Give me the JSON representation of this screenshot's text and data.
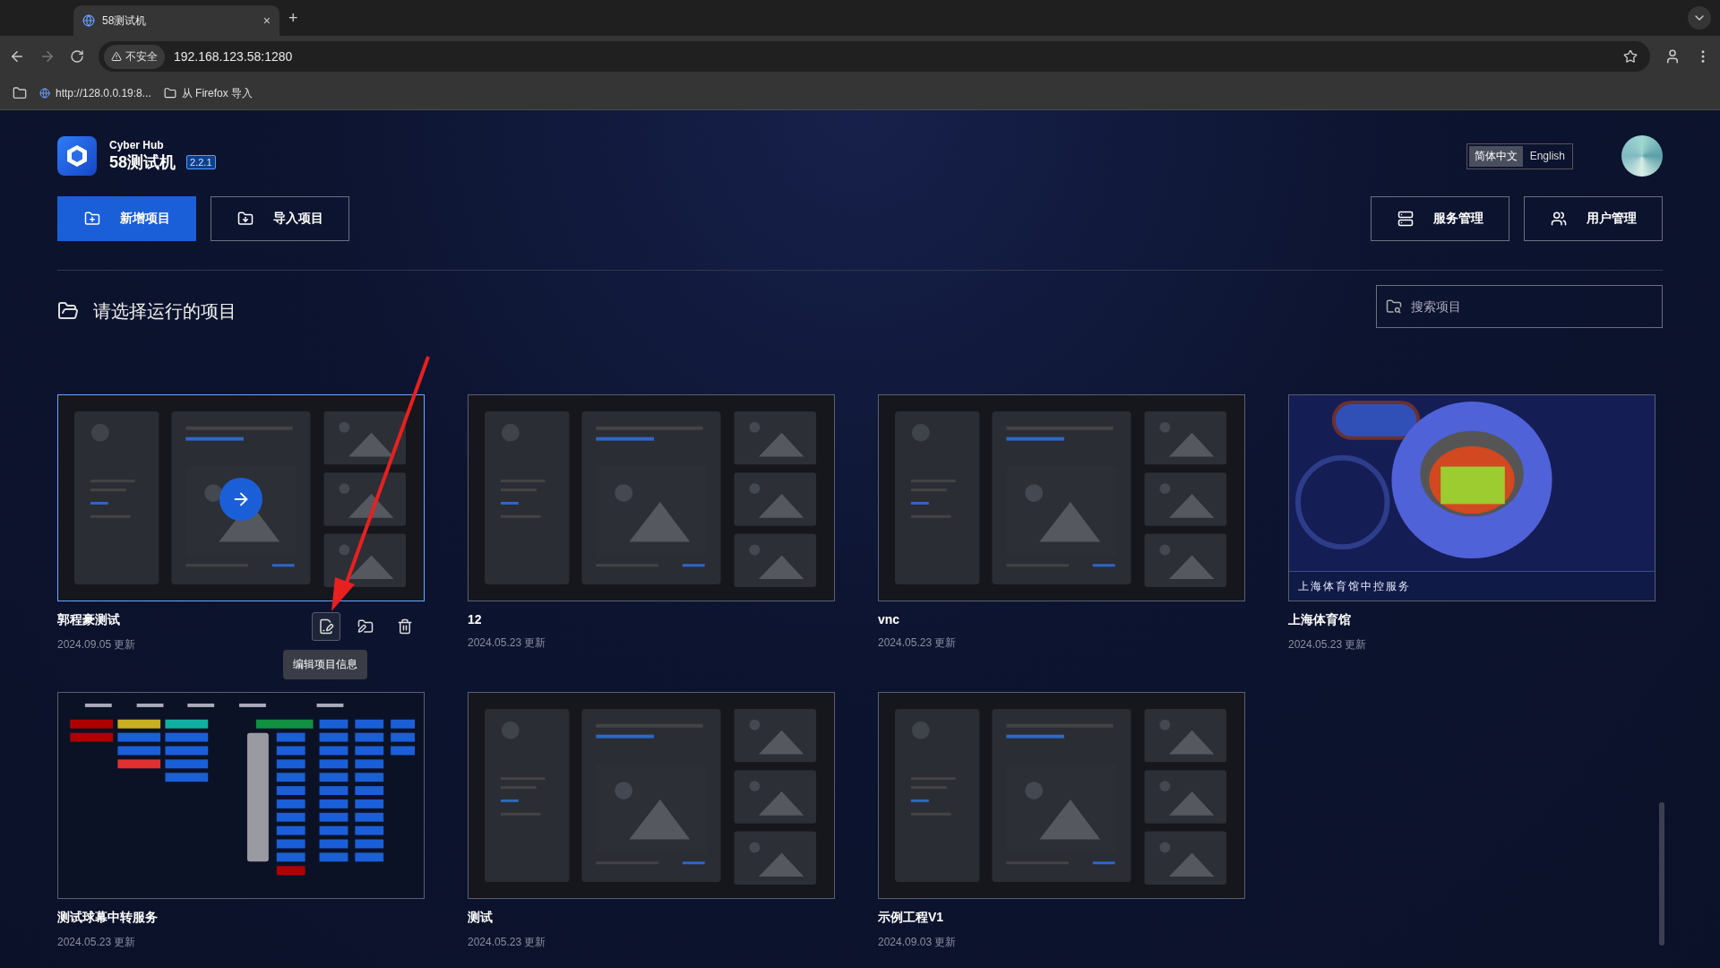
{
  "browser": {
    "tab": {
      "title": "58测试机",
      "close": "×"
    },
    "new_tab": "+",
    "security": "不安全",
    "url": "192.168.123.58:1280",
    "bookmarks": [
      "http://128.0.0.19:8...",
      "从 Firefox 导入"
    ]
  },
  "header": {
    "brand": "Cyber Hub",
    "title": "58测试机",
    "version": "2.2.1",
    "languages": [
      {
        "label": "简体中文",
        "selected": true
      },
      {
        "label": "English",
        "selected": false
      }
    ]
  },
  "actions_left": [
    {
      "label": "新增项目",
      "kind": "primary"
    },
    {
      "label": "导入项目",
      "kind": "outline"
    }
  ],
  "actions_right": [
    {
      "label": "服务管理"
    },
    {
      "label": "用户管理"
    }
  ],
  "section": {
    "title": "请选择运行的项目",
    "search": {
      "placeholder": "搜索项目"
    }
  },
  "projects": [
    {
      "name": "郭程豪测试",
      "date": "2024.09.05 更新",
      "kind": "template",
      "hovered": true,
      "tooltip": "编辑项目信息"
    },
    {
      "name": "12",
      "date": "2024.05.23 更新",
      "kind": "template",
      "hovered": false
    },
    {
      "name": "vnc",
      "date": "2024.05.23 更新",
      "kind": "template",
      "hovered": false
    },
    {
      "name": "上海体育馆",
      "date": "2024.05.23 更新",
      "kind": "stadium",
      "hovered": false,
      "thumb_title": "上海体育馆中控服务"
    },
    {
      "name": "测试球幕中转服务",
      "date": "2024.05.23 更新",
      "kind": "panel",
      "hovered": false
    },
    {
      "name": "测试",
      "date": "2024.05.23 更新",
      "kind": "template",
      "hovered": false
    },
    {
      "name": "示例工程V1",
      "date": "2024.09.03 更新",
      "kind": "template",
      "hovered": false
    }
  ]
}
